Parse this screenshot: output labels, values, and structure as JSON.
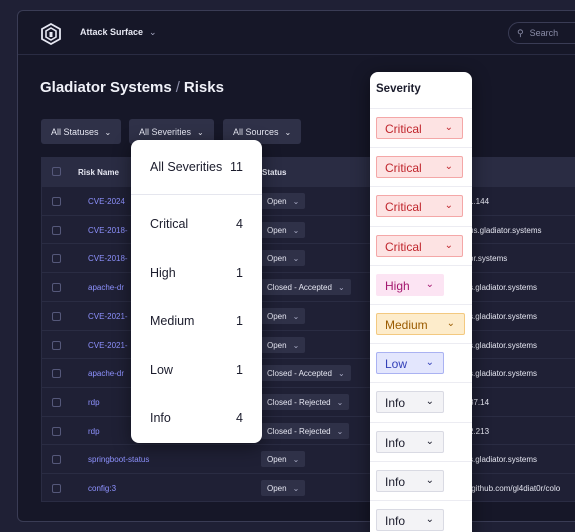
{
  "topbar": {
    "app_name": "Attack Surface",
    "search_placeholder": "Search"
  },
  "breadcrumb": {
    "org": "Gladiator Systems",
    "separator": "/",
    "page": "Risks"
  },
  "filters": {
    "statuses": "All Statuses",
    "severities": "All Severities",
    "sources": "All Sources"
  },
  "table": {
    "headers": {
      "name": "Risk Name",
      "status": "Status"
    },
    "rows": [
      {
        "name": "CVE-2024",
        "status": "Open",
        "asset": "1.144"
      },
      {
        "name": "CVE-2018-",
        "status": "Open",
        "asset": "us.gladiator.systems"
      },
      {
        "name": "CVE-2018-",
        "status": "Open",
        "asset": "or.systems"
      },
      {
        "name": "apache-dr",
        "status": "Closed - Accepted",
        "asset": "s.gladiator.systems"
      },
      {
        "name": "CVE-2021-",
        "status": "Open",
        "asset": "s.gladiator.systems"
      },
      {
        "name": "CVE-2021-",
        "status": "Open",
        "asset": "s.gladiator.systems"
      },
      {
        "name": "apache-dr",
        "status": "Closed - Accepted",
        "asset": "s.gladiator.systems"
      },
      {
        "name": "rdp",
        "status": "Closed - Rejected",
        "asset": "87.14"
      },
      {
        "name": "rdp",
        "status": "Closed - Rejected",
        "asset": "2.213"
      },
      {
        "name": "springboot-status",
        "status": "Open",
        "asset": "s.gladiator.systems"
      },
      {
        "name": "config:3",
        "status": "Open",
        "asset": "/github.com/gl4diat0r/colo"
      }
    ]
  },
  "severity_dropdown": {
    "options": [
      {
        "label": "All Severities",
        "count": "11"
      },
      {
        "label": "Critical",
        "count": "4"
      },
      {
        "label": "High",
        "count": "1"
      },
      {
        "label": "Medium",
        "count": "1"
      },
      {
        "label": "Low",
        "count": "1"
      },
      {
        "label": "Info",
        "count": "4"
      }
    ]
  },
  "severity_column": {
    "title": "Severity",
    "values": [
      "Critical",
      "Critical",
      "Critical",
      "Critical",
      "High",
      "Medium",
      "Low",
      "Info",
      "Info",
      "Info",
      "Info"
    ]
  },
  "colors": {
    "critical_bg": "#fde3e3",
    "critical_fg": "#c0262d",
    "critical_border": "#f4a7a7",
    "high_bg": "#fce4f3",
    "high_fg": "#a4176f",
    "medium_bg": "#fdeccb",
    "medium_fg": "#9a5b00",
    "medium_border": "#f3c980",
    "low_bg": "#e3e6fd",
    "low_fg": "#3340b8",
    "low_border": "#aab2f2",
    "info_bg": "#f3f3f6",
    "info_fg": "#1b1c2c",
    "info_border": "#d9dae3",
    "link": "#8e92ff"
  },
  "icons": {
    "logo": "gladiator-logo-icon",
    "search": "search-icon",
    "chevron": "chevron-down-icon"
  }
}
